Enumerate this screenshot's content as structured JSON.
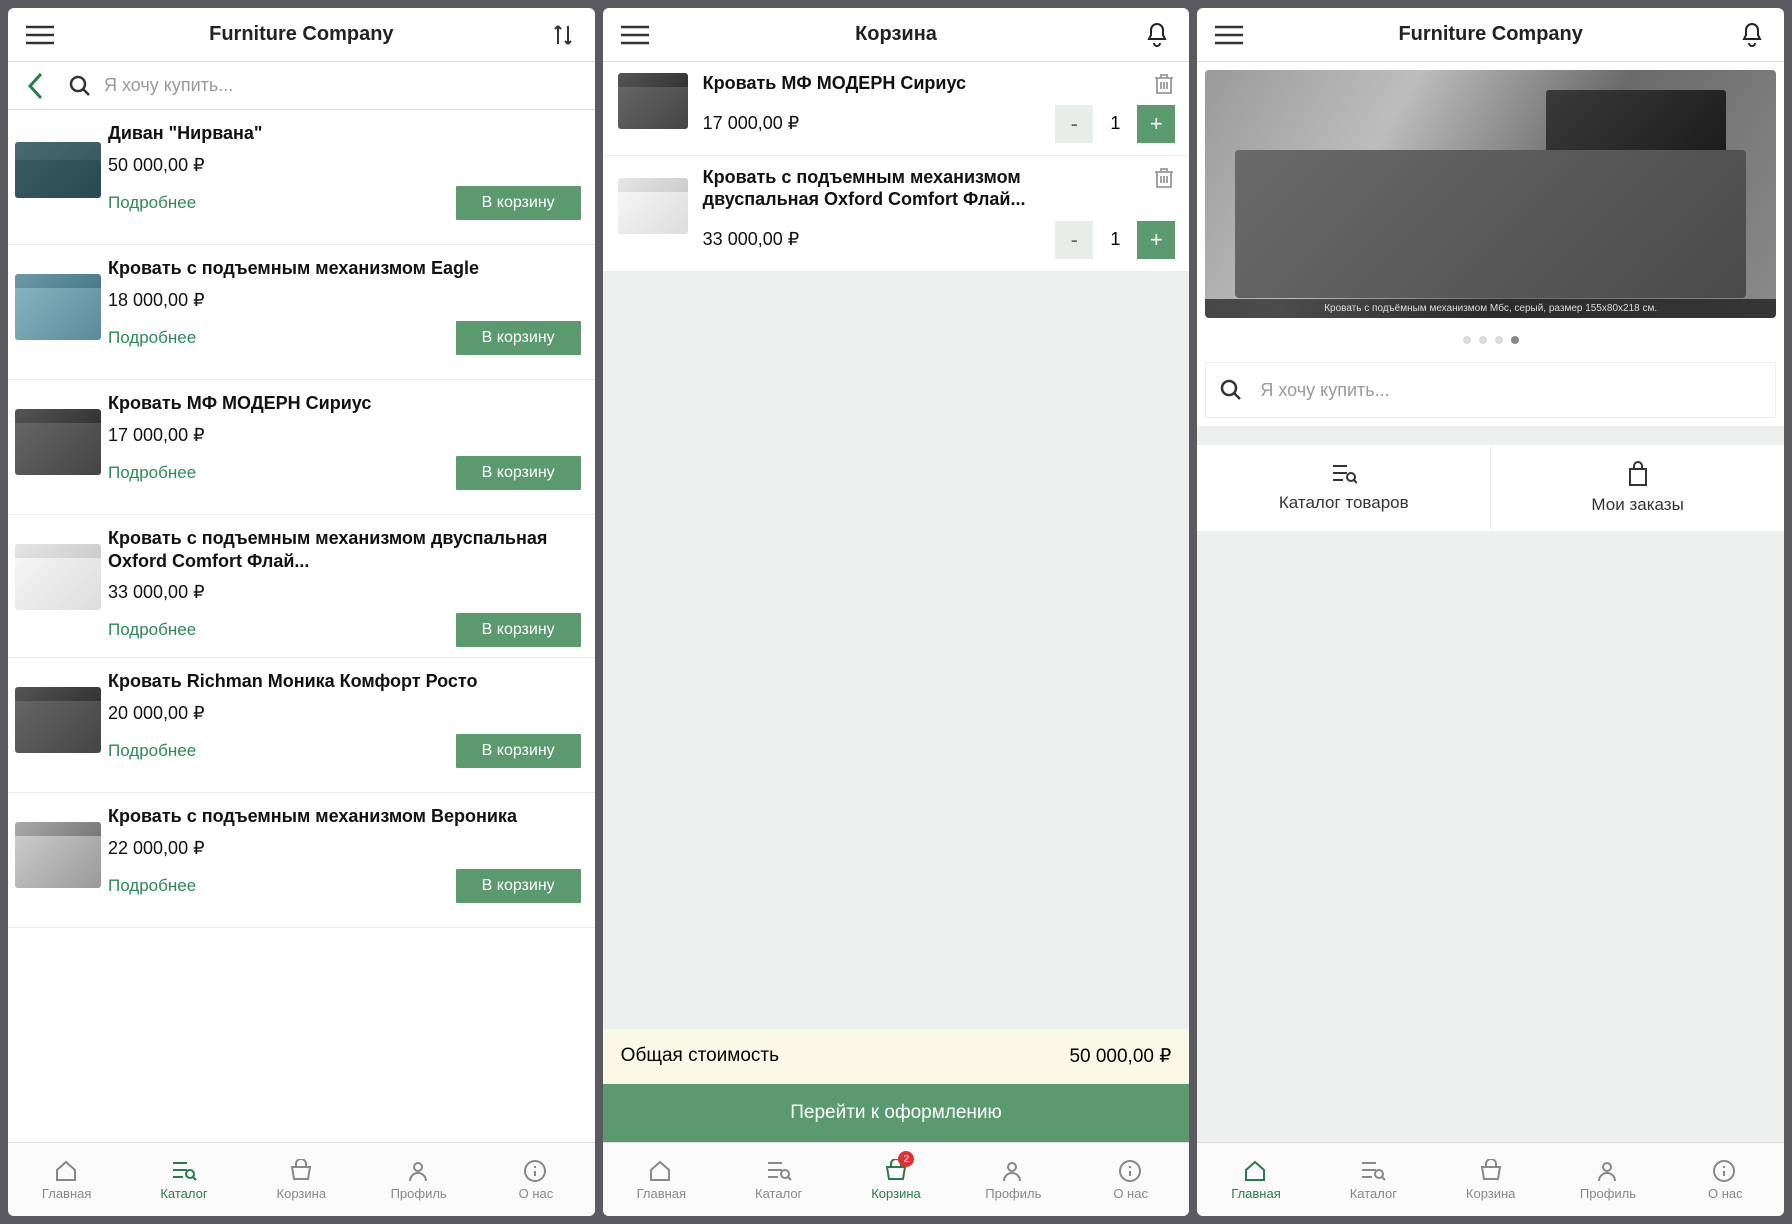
{
  "panel1": {
    "title": "Furniture Company",
    "search_placeholder": "Я хочу купить...",
    "more_label": "Подробнее",
    "cart_label": "В корзину",
    "products": [
      {
        "name": "Диван \"Нирвана\"",
        "price": "50 000,00 ₽",
        "style": "sofa"
      },
      {
        "name": "Кровать с подъемным механизмом Eagle",
        "price": "18 000,00 ₽",
        "style": "blue"
      },
      {
        "name": "Кровать МФ МОДЕРН Сириус",
        "price": "17 000,00 ₽",
        "style": "dark"
      },
      {
        "name": "Кровать с подъемным механизмом двуспальная Oxford Comfort Флай...",
        "price": "33 000,00 ₽",
        "style": "white"
      },
      {
        "name": "Кровать Richman Моника Комфорт Росто",
        "price": "20 000,00 ₽",
        "style": "dark"
      },
      {
        "name": "Кровать с подъемным механизмом Вероника",
        "price": "22 000,00 ₽",
        "style": ""
      }
    ]
  },
  "panel2": {
    "title": "Корзина",
    "items": [
      {
        "name": "Кровать МФ МОДЕРН Сириус",
        "price": "17 000,00 ₽",
        "qty": "1",
        "style": "dark"
      },
      {
        "name": "Кровать с подъемным механизмом двуспальная Oxford Comfort Флай...",
        "price": "33 000,00 ₽",
        "qty": "1",
        "style": "white"
      }
    ],
    "total_label": "Общая стоимость",
    "total_value": "50 000,00 ₽",
    "checkout_label": "Перейти к оформлению",
    "badge": "2"
  },
  "panel3": {
    "title": "Furniture Company",
    "hero_caption": "Кровать с подъёмным механизмом Мбс, серый, размер 155х80х218 см.",
    "search_placeholder": "Я хочу купить...",
    "catalog_label": "Каталог товаров",
    "orders_label": "Мои заказы"
  },
  "tabs": {
    "home": "Главная",
    "catalog": "Каталог",
    "cart": "Корзина",
    "profile": "Профиль",
    "about": "О нас"
  }
}
